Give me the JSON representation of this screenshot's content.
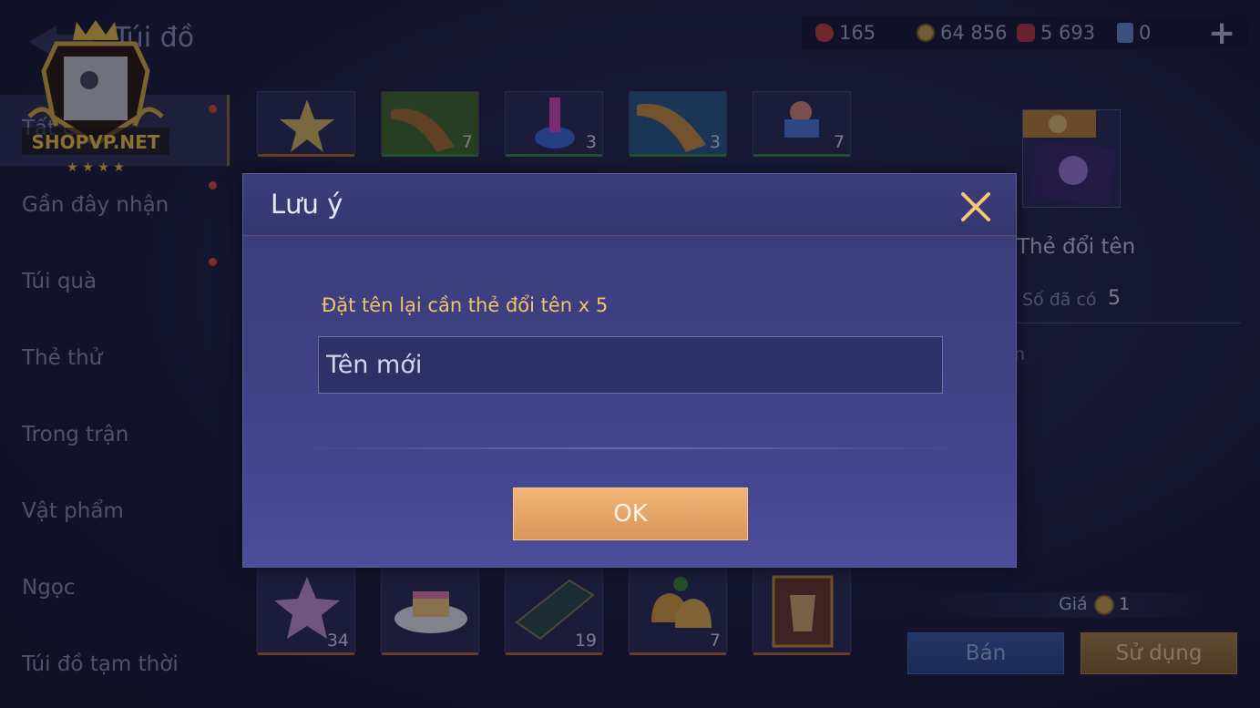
{
  "header": {
    "title": "Túi đồ",
    "currencies": [
      {
        "name": "red-gem",
        "value": "165",
        "color": "#c0443a"
      },
      {
        "name": "gold-coin",
        "value": "64 856",
        "color": "#c8a050"
      },
      {
        "name": "ruby",
        "value": "5 693",
        "color": "#b83a40"
      },
      {
        "name": "voucher",
        "value": "0",
        "color": "#6a8ad8"
      }
    ],
    "plus_label": "+"
  },
  "sidebar": {
    "items": [
      {
        "label": "Tất cả"
      },
      {
        "label": "Gần đây nhận"
      },
      {
        "label": "Túi quà"
      },
      {
        "label": "Thẻ thử"
      },
      {
        "label": "Trong trận"
      },
      {
        "label": "Vật phẩm"
      },
      {
        "label": "Ngọc"
      },
      {
        "label": "Túi đồ tạm thời"
      }
    ]
  },
  "grid": {
    "top_row_counts": [
      "",
      "7",
      "3",
      "3",
      "7"
    ],
    "bottom_row_counts": [
      "34",
      "",
      "19",
      "7",
      ""
    ]
  },
  "detail": {
    "name": "Thẻ đổi tên",
    "owned_label": "Số đã có",
    "owned_value": "5",
    "desc_fragment": "n",
    "price_label": "Giá",
    "price_value": "1",
    "sell_label": "Bán",
    "use_label": "Sử dụng"
  },
  "modal": {
    "title": "Lưu ý",
    "message": "Đặt tên lại cần thẻ đổi tên x 5",
    "input_placeholder": "Tên mới",
    "ok_label": "OK"
  },
  "watermark": {
    "text": "SHOPVP.NET"
  }
}
